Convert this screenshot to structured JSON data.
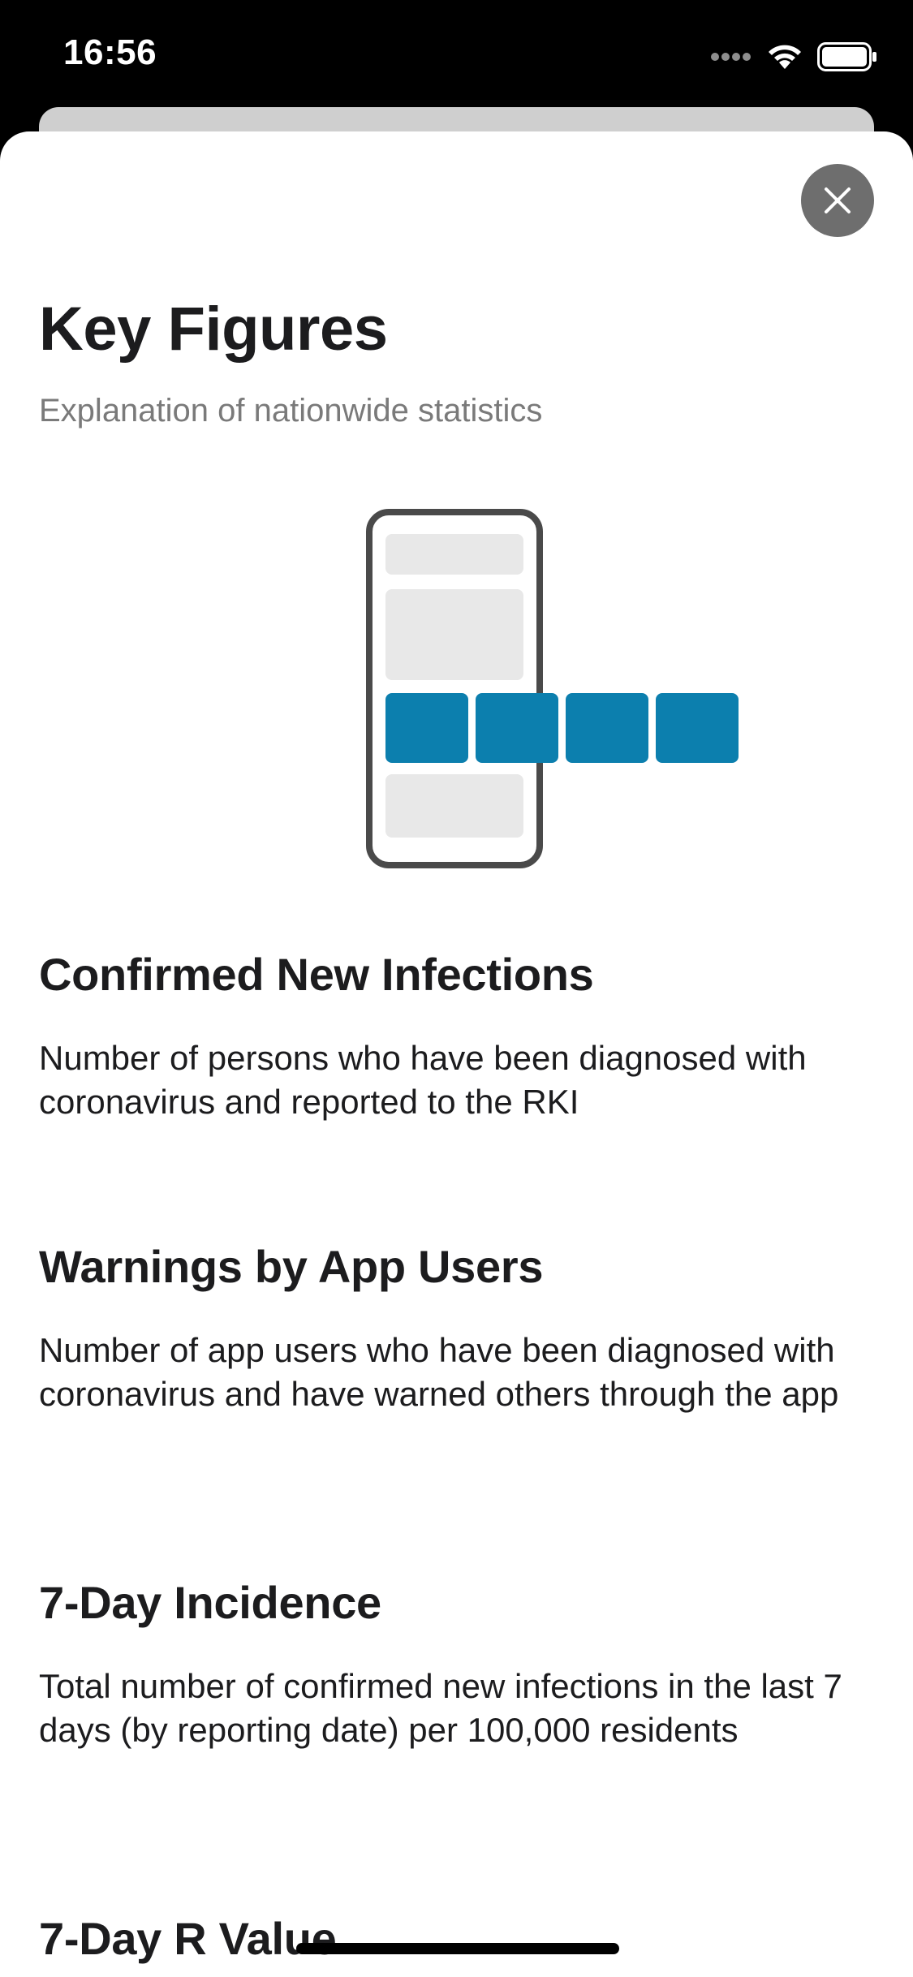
{
  "status_bar": {
    "time": "16:56",
    "icons": [
      "signal-dots-icon",
      "wifi-icon",
      "battery-icon"
    ]
  },
  "sheet": {
    "close_icon": "close-icon",
    "title": "Key Figures",
    "subtitle": "Explanation of nationwide statistics",
    "illustration": "phone-with-key-figure-tiles",
    "accent_color": "#0c7fae",
    "sections": [
      {
        "heading": "Confirmed New Infections",
        "text": "Number of persons who have been diagnosed with coronavirus and reported to the RKI"
      },
      {
        "heading": "Warnings by App Users",
        "text": "Number of app users who have been diagnosed with coronavirus and have warned others through the app"
      },
      {
        "heading": "7-Day Incidence",
        "text": "Total number of confirmed new infections in the last 7 days (by reporting date) per 100,000 residents"
      },
      {
        "heading": "7-Day R Value",
        "text": ""
      }
    ]
  }
}
